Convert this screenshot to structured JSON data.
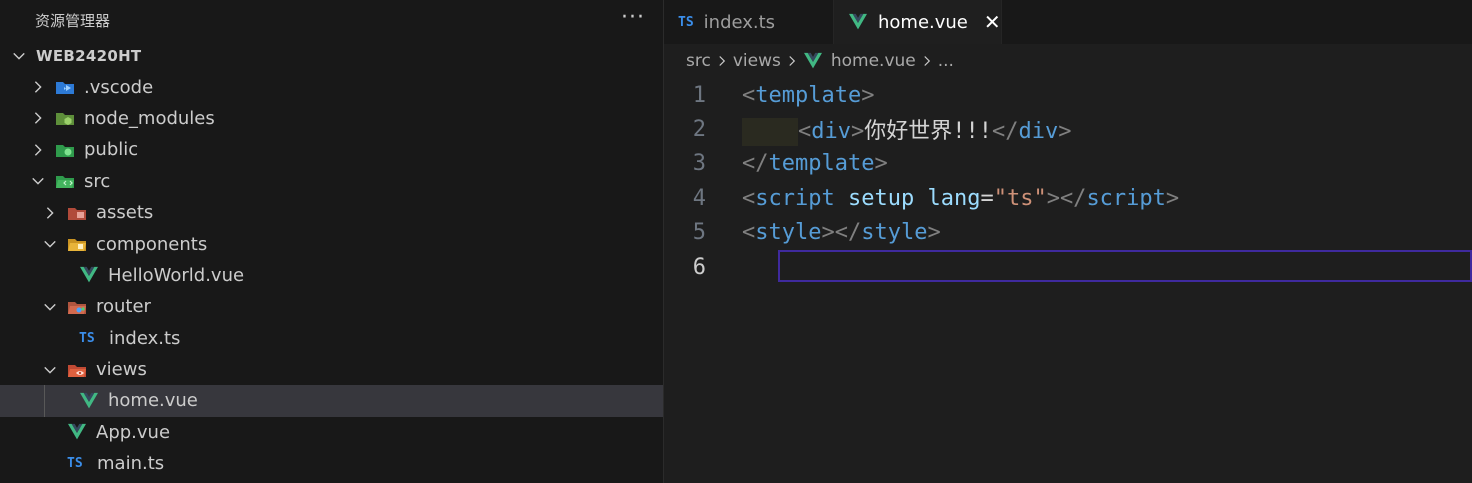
{
  "sidebar": {
    "title": "资源管理器",
    "more_label": "···",
    "root": "WEB2420HT",
    "items": [
      {
        "label": ".vscode",
        "icon": "vscode-folder-icon"
      },
      {
        "label": "node_modules",
        "icon": "node-folder-icon"
      },
      {
        "label": "public",
        "icon": "public-folder-icon"
      },
      {
        "label": "src",
        "icon": "src-folder-icon"
      },
      {
        "label": "assets",
        "icon": "assets-folder-icon"
      },
      {
        "label": "components",
        "icon": "components-folder-icon"
      },
      {
        "label": "HelloWorld.vue",
        "icon": "vue-file-icon"
      },
      {
        "label": "router",
        "icon": "router-folder-icon"
      },
      {
        "label": "index.ts",
        "icon": "ts-file-icon",
        "badge": "TS"
      },
      {
        "label": "views",
        "icon": "views-folder-icon"
      },
      {
        "label": "home.vue",
        "icon": "vue-file-icon"
      },
      {
        "label": "App.vue",
        "icon": "vue-file-icon"
      },
      {
        "label": "main.ts",
        "icon": "ts-file-icon",
        "badge": "TS"
      }
    ]
  },
  "tabs": [
    {
      "label": "index.ts",
      "badge": "TS",
      "active": false
    },
    {
      "label": "home.vue",
      "active": true,
      "close": "✕"
    }
  ],
  "breadcrumb": {
    "parts": [
      "src",
      "views",
      "home.vue",
      "..."
    ]
  },
  "code": {
    "line_numbers": [
      "1",
      "2",
      "3",
      "4",
      "5",
      "6"
    ],
    "line1": {
      "open": "<",
      "tag": "template",
      "close": ">"
    },
    "line2": {
      "open": "<",
      "tag": "div",
      "close": ">",
      "text": "你好世界!!!",
      "end_open": "</",
      "end_tag": "div",
      "end_close": ">"
    },
    "line3": {
      "open": "</",
      "tag": "template",
      "close": ">"
    },
    "line4": {
      "open": "<",
      "tag": "script",
      "attr1": "setup",
      "attr2": "lang",
      "eq": "=",
      "value": "\"ts\"",
      "close": ">",
      "end_open": "</",
      "end_tag": "script",
      "end_close": ">"
    },
    "line5": {
      "open": "<",
      "tag": "style",
      "close": ">",
      "end_open": "</",
      "end_tag": "style",
      "end_close": ">"
    }
  },
  "colors": {
    "ts_badge": "#3b8eea",
    "vue_green": "#41b883",
    "tag_blue": "#569cd6",
    "string": "#ce9178",
    "attr": "#9cdcfe",
    "cursor_line_border": "#3f2a9e"
  }
}
